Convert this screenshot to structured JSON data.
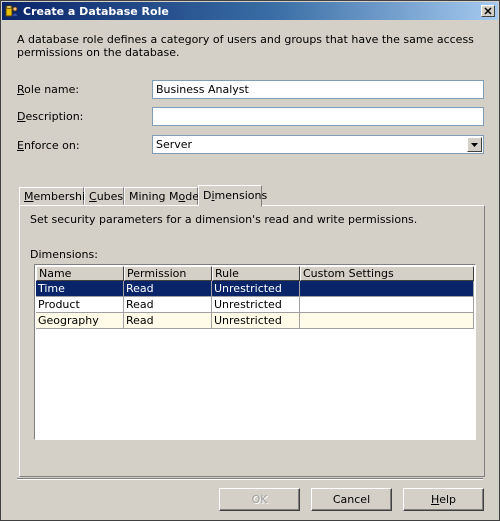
{
  "window": {
    "title": "Create a Database Role"
  },
  "intro": "A database role defines a category of users and groups that have the same access permissions on the database.",
  "form": {
    "role_name": {
      "label_key": "R",
      "label_rest": "ole name:",
      "value": "Business Analyst"
    },
    "description": {
      "label_key": "D",
      "label_rest": "escription:",
      "value": ""
    },
    "enforce_on": {
      "label_key": "E",
      "label_rest": "nforce on:",
      "value": "Server"
    }
  },
  "tabs": [
    {
      "key": "M",
      "rest": "embership"
    },
    {
      "key": "C",
      "rest": "ubes"
    },
    {
      "pre": "Mining M",
      "key": "o",
      "rest": "dels"
    },
    {
      "pre": "D",
      "key": "i",
      "rest": "mensions"
    }
  ],
  "active_tab": "Dimensions",
  "panel": {
    "description": "Set security parameters for a dimension's read and write permissions.",
    "list_label": "Dimensions:",
    "columns": [
      "Name",
      "Permission",
      "Rule",
      "Custom Settings"
    ],
    "rows": [
      {
        "name": "Time",
        "permission": "Read",
        "rule": "Unrestricted",
        "custom": "",
        "selected": true
      },
      {
        "name": "Product",
        "permission": "Read",
        "rule": "Unrestricted",
        "custom": "",
        "selected": false
      },
      {
        "name": "Geography",
        "permission": "Read",
        "rule": "Unrestricted",
        "custom": "",
        "selected": false
      }
    ]
  },
  "buttons": {
    "ok": "OK",
    "cancel": "Cancel",
    "help_key": "H",
    "help_rest": "elp"
  },
  "colors": {
    "selection": "#0a246a",
    "title_gradient_start": "#0a246a",
    "dialog_face": "#d4d0c8"
  },
  "icons": [
    "database-role-icon",
    "close-icon",
    "dropdown-arrow-icon"
  ]
}
